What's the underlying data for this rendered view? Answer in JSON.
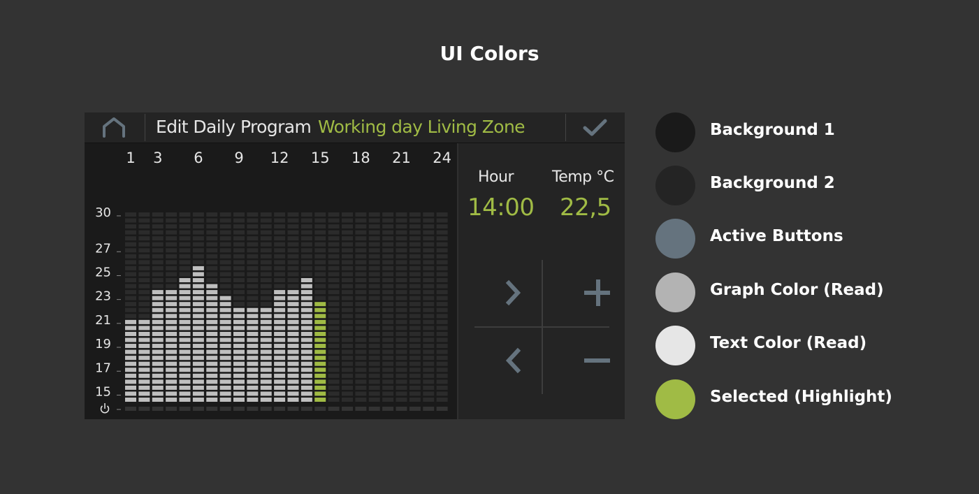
{
  "page": {
    "title": "UI Colors"
  },
  "device": {
    "topbar": {
      "title": "Edit Daily Program",
      "subtitle": "Working day Living Zone",
      "home_icon": "home-icon",
      "confirm_icon": "checkmark-icon"
    },
    "panel": {
      "hour_label": "Hour",
      "hour_value": "14:00",
      "temp_label": "Temp °C",
      "temp_value": "22,5",
      "controls": [
        "chevron-right-icon",
        "plus-icon",
        "chevron-left-icon",
        "minus-icon"
      ]
    }
  },
  "chart_data": {
    "type": "bar",
    "x_ticks": [
      "1",
      "3",
      "6",
      "9",
      "12",
      "15",
      "18",
      "21",
      "24"
    ],
    "y_ticks": [
      "30",
      "27",
      "25",
      "23",
      "21",
      "19",
      "17",
      "15"
    ],
    "y_axis_icon": "power-icon",
    "hours": [
      1,
      2,
      3,
      4,
      5,
      6,
      7,
      8,
      9,
      10,
      11,
      12,
      13,
      14,
      15,
      16,
      17,
      18,
      19,
      20,
      21,
      22,
      23,
      24
    ],
    "values": [
      21,
      21,
      23.5,
      23.5,
      24.5,
      25.5,
      24,
      23,
      22,
      22,
      22,
      23.5,
      23.5,
      24.5,
      22.5,
      null,
      null,
      null,
      null,
      null,
      null,
      null,
      null,
      null
    ],
    "selected_hour": 15,
    "ylim": [
      14.5,
      30
    ],
    "colors": {
      "read": "#bfbfbf",
      "selected": "#a0bb45",
      "empty": "#2b2b2b"
    }
  },
  "legend": [
    {
      "label": "Background 1",
      "color": "#1a1a1a"
    },
    {
      "label": "Background 2",
      "color": "#242424"
    },
    {
      "label": "Active Buttons",
      "color": "#65737e"
    },
    {
      "label": "Graph Color (Read)",
      "color": "#b3b3b3"
    },
    {
      "label": "Text Color (Read)",
      "color": "#e6e6e6"
    },
    {
      "label": "Selected (Highlight)",
      "color": "#a0bb45"
    }
  ]
}
